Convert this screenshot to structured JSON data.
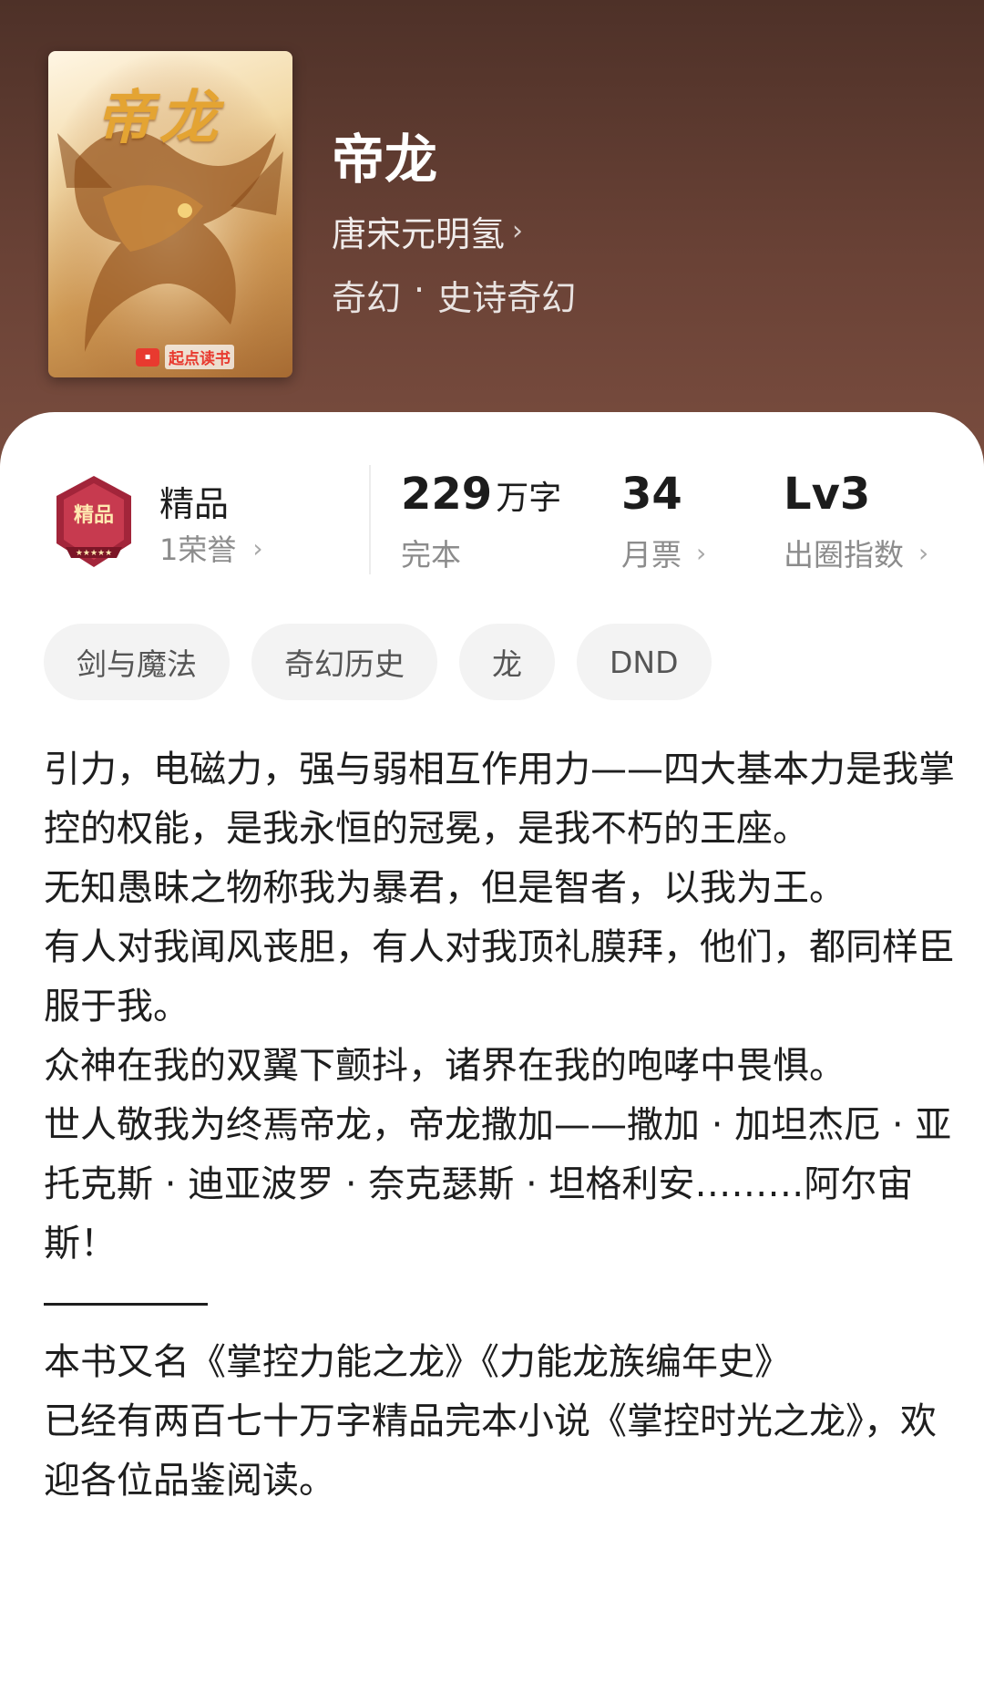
{
  "book": {
    "cover_title": "帝龙",
    "cover_publisher": "起点读书",
    "title": "帝龙",
    "author": "唐宋元明氢",
    "category": "奇幻",
    "separator": "·",
    "subcategory": "史诗奇幻"
  },
  "honor": {
    "badge_text": "精品",
    "title": "精品",
    "subtitle": "1荣誉"
  },
  "stats": {
    "words_value": "229",
    "words_unit": "万字",
    "words_label": "完本",
    "monthly_value": "34",
    "monthly_label": "月票",
    "level_value": "Lv3",
    "level_label": "出圈指数"
  },
  "tags": [
    "剑与魔法",
    "奇幻历史",
    "龙",
    "DND"
  ],
  "description": {
    "p1": "引力，电磁力，强与弱相互作用力——四大基本力是我掌控的权能，是我永恒的冠冕，是我不朽的王座。",
    "p2": "无知愚昧之物称我为暴君，但是智者，以我为王。",
    "p3": "有人对我闻风丧胆，有人对我顶礼膜拜，他们，都同样臣服于我。",
    "p4": "众神在我的双翼下颤抖，诸界在我的咆哮中畏惧。",
    "p5": "世人敬我为终焉帝龙，帝龙撒加——撒加 · 加坦杰厄 · 亚托克斯 · 迪亚波罗 · 奈克瑟斯 · 坦格利安………阿尔宙斯！",
    "p6": "本书又名《掌控力能之龙》《力能龙族编年史》",
    "p7": "已经有两百七十万字精品完本小说《掌控时光之龙》，欢迎各位品鉴阅读。"
  },
  "colors": {
    "header_bg": "#5a382d",
    "card_bg": "#ffffff",
    "tag_bg": "#f3f3f3",
    "text_primary": "#1c1c1c",
    "text_secondary": "#8c8c8c"
  },
  "icons": {
    "chevron": "chevron-right-icon",
    "badge": "premium-badge-icon"
  }
}
